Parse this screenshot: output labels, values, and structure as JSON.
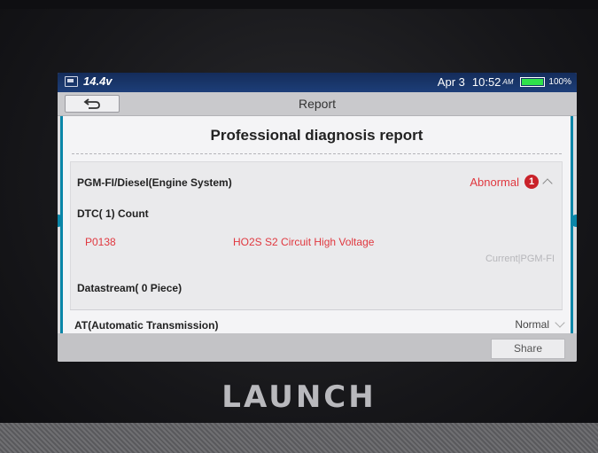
{
  "device": {
    "brand": "LAUNCH"
  },
  "status_bar": {
    "voltage": "14.4v",
    "date": "Apr 3",
    "time": "10:52",
    "ampm": "AM",
    "battery": "100%",
    "battery_color": "#2fe14a"
  },
  "title_bar": {
    "title": "Report",
    "back_icon": "back-arrow-icon"
  },
  "report": {
    "heading": "Professional diagnosis report",
    "sections": [
      {
        "title": "PGM-FI/Diesel(Engine System)",
        "status": "Abnormal",
        "badge": "1",
        "dtc_count_label": "DTC( 1) Count",
        "dtcs": [
          {
            "code": "P0138",
            "description": "HO2S S2 Circuit High Voltage",
            "system": "Current|PGM-FI"
          }
        ],
        "datastream_label": "Datastream( 0 Piece)"
      },
      {
        "title": "AT(Automatic Transmission)",
        "status": "Normal"
      }
    ]
  },
  "footer": {
    "share_label": "Share"
  },
  "colors": {
    "accent": "#0a86a8",
    "abnormal": "#e0383f",
    "badge": "#c9222a",
    "status_bar": "#1d3e78"
  }
}
